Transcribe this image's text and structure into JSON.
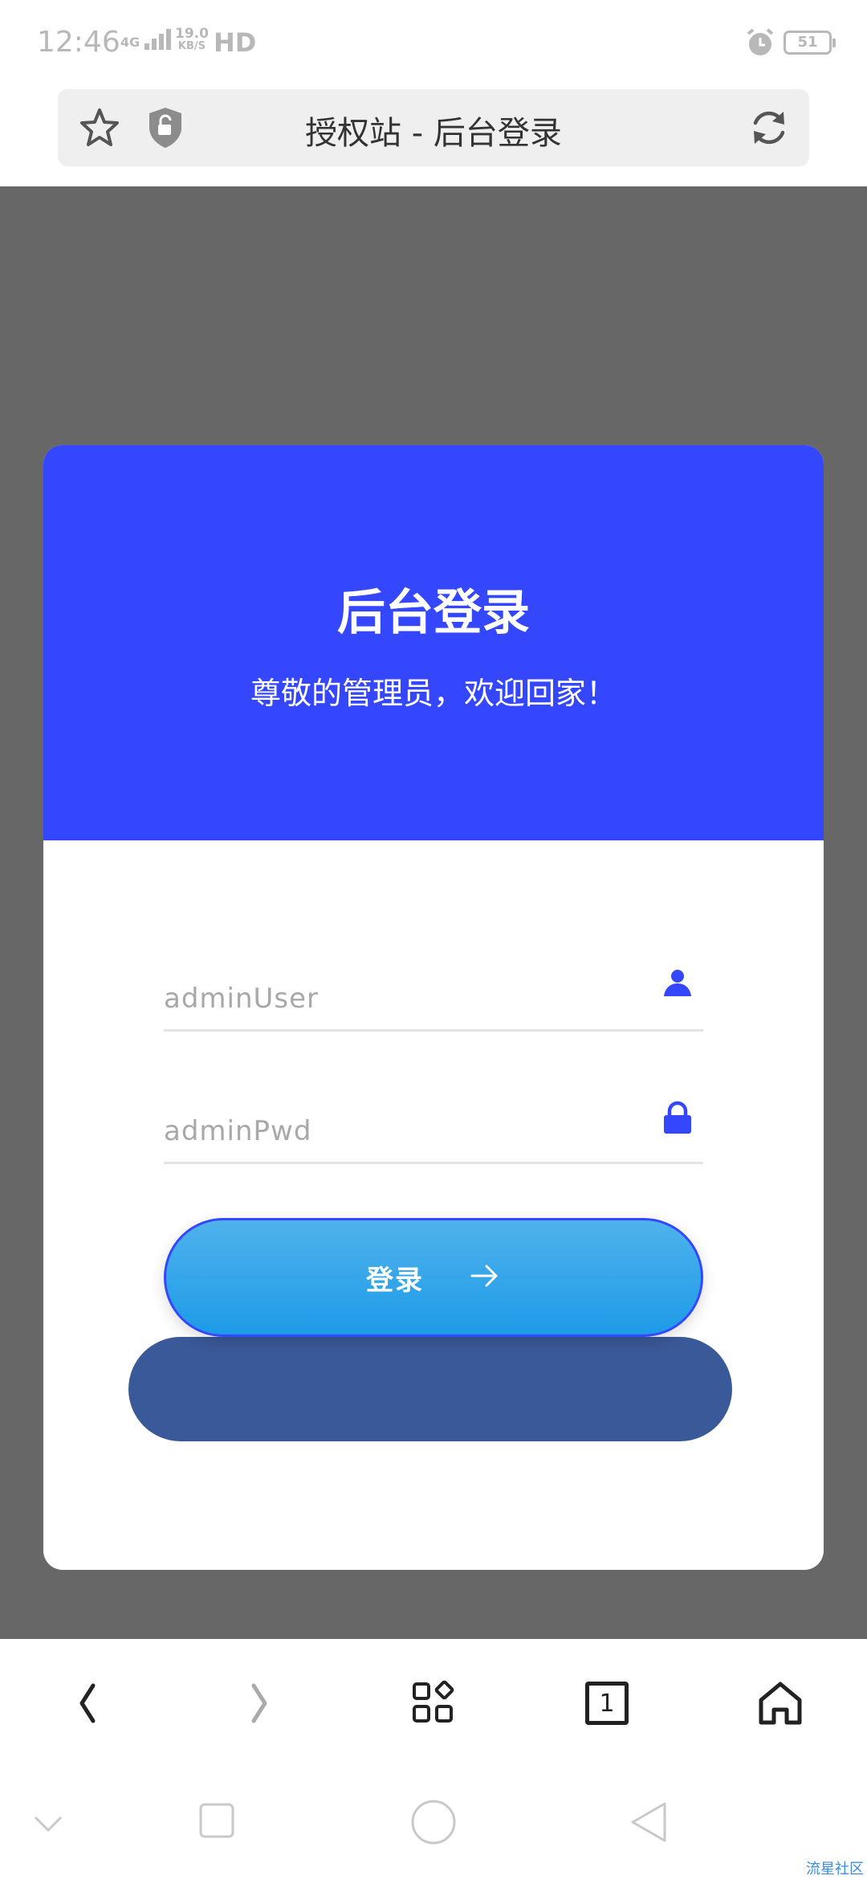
{
  "status_bar": {
    "time": "12:46",
    "network": "4G",
    "speed_value": "19.0",
    "speed_unit": "KB/S",
    "hd": "HD",
    "battery": "51"
  },
  "address_bar": {
    "title": "授权站 - 后台登录"
  },
  "login_card": {
    "title": "后台登录",
    "subtitle": "尊敬的管理员，欢迎回家！",
    "username_placeholder": "adminUser",
    "password_placeholder": "adminPwd",
    "login_label": "登录"
  },
  "toolbar": {
    "tab_count": "1"
  },
  "watermark": "流星社区",
  "colors": {
    "header_blue": "#3447fd",
    "button_gradient_top": "#4fb2ec",
    "button_gradient_bottom": "#1d9be8",
    "backdrop_gray": "#676767",
    "shadow_blue": "#3a5998"
  }
}
